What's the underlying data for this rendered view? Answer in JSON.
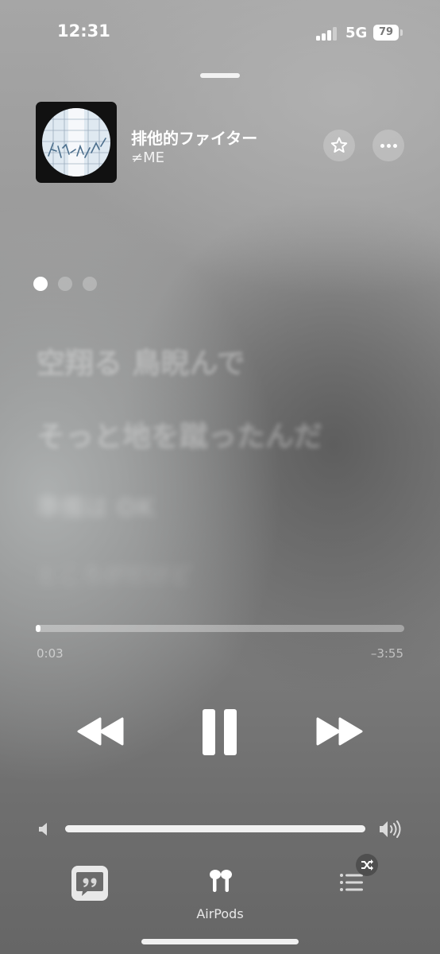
{
  "status_bar": {
    "time": "12:31",
    "network": "5G",
    "battery": "79"
  },
  "now_playing": {
    "title": "排他的ファイター",
    "artist": "≠ME",
    "favorited": false
  },
  "lyrics": {
    "page_count": 3,
    "current_page": 1,
    "lines": [
      "空翔る 鳥睨んで",
      "そっと地を蹴ったんだ",
      "準備は OK",
      "ところがだけど"
    ]
  },
  "playback": {
    "elapsed": "0:03",
    "remaining": "–3:55",
    "progress": 0.013,
    "state": "playing"
  },
  "volume": {
    "level": 1.0
  },
  "bottom_bar": {
    "output_device": "AirPods"
  },
  "colors": {
    "accent": "#ffffff",
    "background_top": "#a6a6a6",
    "background_bottom": "#666666"
  }
}
